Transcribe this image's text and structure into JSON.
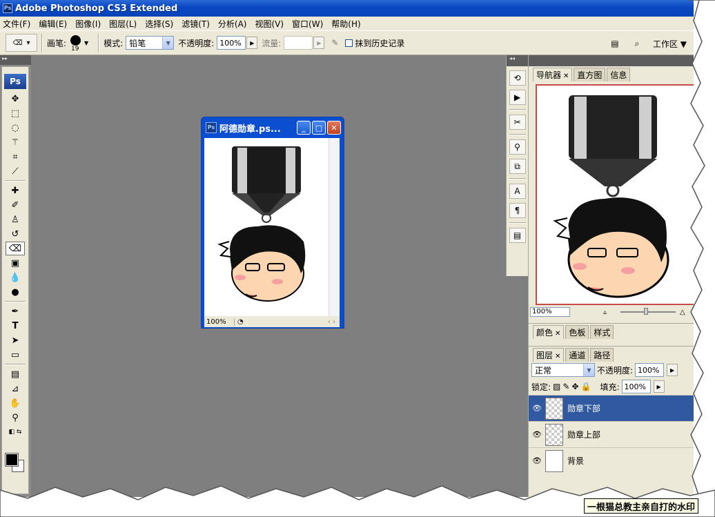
{
  "app": {
    "title": "Adobe Photoshop CS3 Extended",
    "logo": "Ps"
  },
  "menu": [
    "文件(F)",
    "编辑(E)",
    "图像(I)",
    "图层(L)",
    "选择(S)",
    "滤镜(T)",
    "分析(A)",
    "视图(V)",
    "窗口(W)",
    "帮助(H)"
  ],
  "options": {
    "brush_label": "画笔:",
    "brush_size": "19",
    "mode_label": "模式:",
    "mode_value": "铅笔",
    "opacity_label": "不透明度:",
    "opacity_value": "100%",
    "flow_label": "流量:",
    "erase_history_label": "抹到历史记录",
    "workspace_label": "工作区"
  },
  "toolbox": {
    "badge": "Ps"
  },
  "document": {
    "title": "阿德勋章.ps...",
    "zoom": "100%"
  },
  "navigator": {
    "tabs": [
      "导航器",
      "直方图",
      "信息"
    ],
    "zoom": "100%"
  },
  "color_panel": {
    "tabs": [
      "颜色",
      "色板",
      "样式"
    ]
  },
  "layers_panel": {
    "tabs": [
      "图层",
      "通道",
      "路径"
    ],
    "blend_mode": "正常",
    "opacity_label": "不透明度:",
    "opacity_value": "100%",
    "lock_label": "锁定:",
    "fill_label": "填充:",
    "fill_value": "100%",
    "layers": [
      {
        "name": "勋章下部",
        "selected": true
      },
      {
        "name": "勋章上部",
        "selected": false
      },
      {
        "name": "背景",
        "selected": false
      }
    ]
  },
  "watermark": "一根猫总教主亲自打的水印",
  "colors": {
    "titlebar": "#0a49c4",
    "workspace": "#7f7f7f",
    "selection": "#31599f",
    "chrome": "#ece9d8"
  }
}
